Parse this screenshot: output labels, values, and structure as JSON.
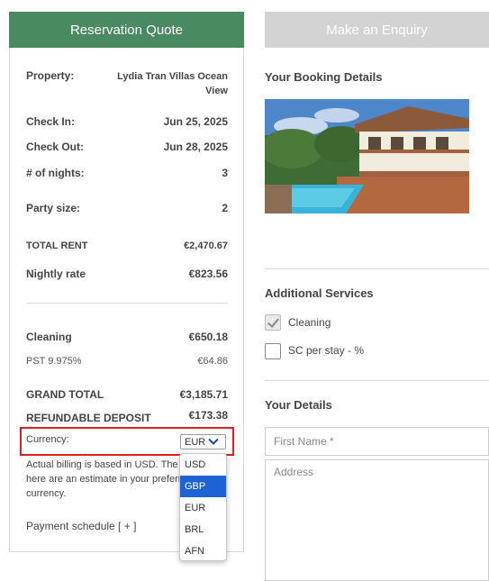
{
  "quote": {
    "header": "Reservation Quote",
    "property_label": "Property:",
    "property_value": "Lydia Tran Villas Ocean View",
    "checkin_label": "Check In:",
    "checkin_value": "Jun 25, 2025",
    "checkout_label": "Check Out:",
    "checkout_value": "Jun 28, 2025",
    "nights_label": "# of nights:",
    "nights_value": "3",
    "party_label": "Party size:",
    "party_value": "2",
    "total_rent_label": "TOTAL RENT",
    "total_rent_value": "€2,470.67",
    "nightly_label": "Nightly rate",
    "nightly_value": "€823.56",
    "cleaning_label": "Cleaning",
    "cleaning_value": "€650.18",
    "pst_label": "PST 9.975%",
    "pst_value": "€64.86",
    "grand_total_label": "GRAND TOTAL",
    "grand_total_value": "€3,185.71",
    "deposit_label": "REFUNDABLE DEPOSIT",
    "deposit_value": "€173.38",
    "currency_label": "Currency:",
    "currency_selected": "EUR",
    "billing_note": "Actual billing is based in USD. The f... here are an estimate in your prefern... currency.",
    "billing_note_l1": "Actual billing is based in USD. The f",
    "billing_note_l2": "here are an estimate in your preferr",
    "billing_note_l3": "currency.",
    "payment_schedule": "Payment schedule [ + ]"
  },
  "currency_dropdown": {
    "options": [
      "USD",
      "GBP",
      "EUR",
      "BRL",
      "AFN"
    ],
    "highlighted": "GBP"
  },
  "enquiry": {
    "tab_label": "Make an Enquiry",
    "booking_details_title": "Your Booking Details",
    "additional_services_title": "Additional Services",
    "services": [
      {
        "label": "Cleaning",
        "checked": true
      },
      {
        "label": "SC per stay - %",
        "checked": false
      }
    ],
    "your_details_title": "Your Details",
    "first_name_placeholder": "First Name *",
    "address_placeholder": "Address"
  },
  "colors": {
    "quote_header": "#4a8a63",
    "enquiry_tab": "#d3d3d3",
    "highlight_box": "#e02020",
    "dropdown_selected": "#1e63d4"
  }
}
